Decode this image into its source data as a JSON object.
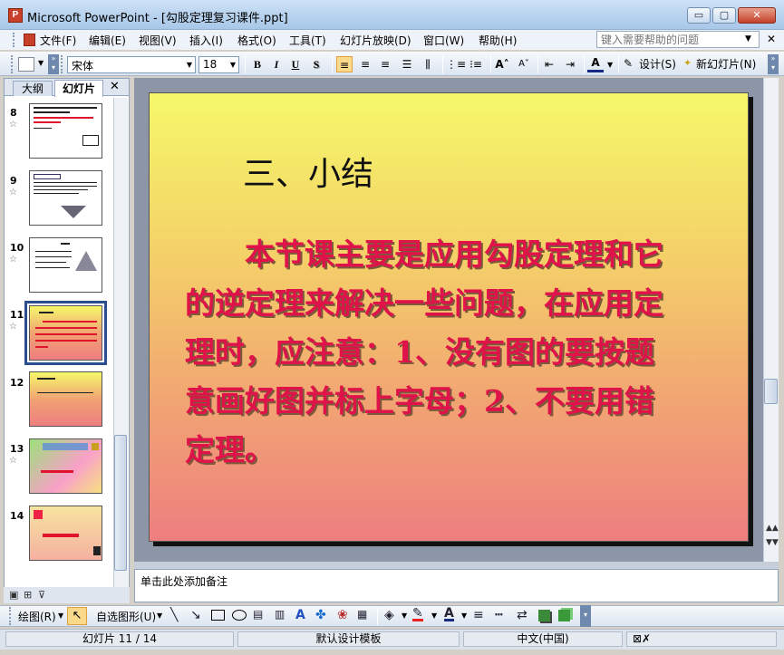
{
  "window": {
    "app_icon": "powerpoint-icon",
    "title": "Microsoft PowerPoint - [勾股定理复习课件.ppt]",
    "min": "▭",
    "max": "▢",
    "close": "✕"
  },
  "menu": {
    "items": [
      "文件(F)",
      "编辑(E)",
      "视图(V)",
      "插入(I)",
      "格式(O)",
      "工具(T)",
      "幻灯片放映(D)",
      "窗口(W)",
      "帮助(H)"
    ],
    "help_placeholder": "键入需要帮助的问题"
  },
  "toolbar": {
    "font": "宋体",
    "size": "18",
    "bold": "B",
    "italic": "I",
    "underline": "U",
    "shadow": "S",
    "design": "设计(S)",
    "new_slide": "新幻灯片(N)"
  },
  "pane": {
    "tab_outline": "大纲",
    "tab_slides": "幻灯片",
    "close": "✕"
  },
  "slides": {
    "numbers": [
      "8",
      "9",
      "10",
      "11",
      "12",
      "13",
      "14"
    ],
    "current_index": 11
  },
  "slide": {
    "title": "三、小结",
    "body_lines": [
      "　　本节课主要是应用勾股定理和它",
      "的逆定理来解决一些问题，在应用定",
      "理时，应注意：1、没有图的要按题",
      "意画好图并标上字母；2、不要用错",
      "定理。"
    ]
  },
  "notes": {
    "placeholder": "单击此处添加备注"
  },
  "drawbar": {
    "draw": "绘图(R)",
    "autoshapes": "自选图形(U)"
  },
  "status": {
    "slide": "幻灯片 11 / 14",
    "template": "默认设计模板",
    "language": "中文(中国)"
  },
  "colors": {
    "body_text": "#e0124a",
    "selection": "#2a4f8c"
  }
}
